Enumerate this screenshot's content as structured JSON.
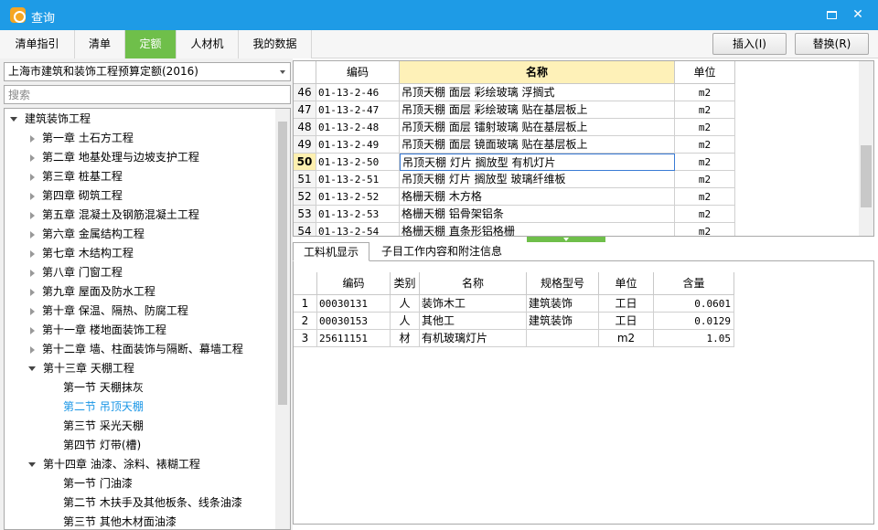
{
  "window": {
    "title": "查询",
    "maximize_icon": "maximize-icon",
    "close_glyph": "✕"
  },
  "tabs": [
    "清单指引",
    "清单",
    "定额",
    "人材机",
    "我的数据"
  ],
  "active_tab": "定额",
  "actions": {
    "insert_label": "插入(I)",
    "replace_label": "替换(R)"
  },
  "left": {
    "library": "上海市建筑和装饰工程预算定额(2016)",
    "search_placeholder": "搜索",
    "tree": [
      {
        "label": "建筑装饰工程",
        "level": 0,
        "state": "open"
      },
      {
        "label": "第一章  土石方工程",
        "level": 1,
        "state": "closed"
      },
      {
        "label": "第二章  地基处理与边坡支护工程",
        "level": 1,
        "state": "closed"
      },
      {
        "label": "第三章  桩基工程",
        "level": 1,
        "state": "closed"
      },
      {
        "label": "第四章  砌筑工程",
        "level": 1,
        "state": "closed"
      },
      {
        "label": "第五章  混凝土及钢筋混凝土工程",
        "level": 1,
        "state": "closed"
      },
      {
        "label": "第六章  金属结构工程",
        "level": 1,
        "state": "closed"
      },
      {
        "label": "第七章  木结构工程",
        "level": 1,
        "state": "closed"
      },
      {
        "label": "第八章  门窗工程",
        "level": 1,
        "state": "closed"
      },
      {
        "label": "第九章  屋面及防水工程",
        "level": 1,
        "state": "closed"
      },
      {
        "label": "第十章  保温、隔热、防腐工程",
        "level": 1,
        "state": "closed"
      },
      {
        "label": "第十一章  楼地面装饰工程",
        "level": 1,
        "state": "closed"
      },
      {
        "label": "第十二章  墙、柱面装饰与隔断、幕墙工程",
        "level": 1,
        "state": "closed"
      },
      {
        "label": "第十三章  天棚工程",
        "level": 1,
        "state": "open"
      },
      {
        "label": "第一节  天棚抹灰",
        "level": 2,
        "state": "leaf"
      },
      {
        "label": "第二节  吊顶天棚",
        "level": 2,
        "state": "leaf",
        "selected": true
      },
      {
        "label": "第三节  采光天棚",
        "level": 2,
        "state": "leaf"
      },
      {
        "label": "第四节  灯带(槽)",
        "level": 2,
        "state": "leaf"
      },
      {
        "label": "第十四章  油漆、涂料、裱糊工程",
        "level": 1,
        "state": "open"
      },
      {
        "label": "第一节  门油漆",
        "level": 2,
        "state": "leaf"
      },
      {
        "label": "第二节  木扶手及其他板条、线条油漆",
        "level": 2,
        "state": "leaf"
      },
      {
        "label": "第三节  其他木材面油漆",
        "level": 2,
        "state": "leaf"
      }
    ]
  },
  "quota_grid": {
    "headers": [
      "编码",
      "名称",
      "单位"
    ],
    "rows": [
      {
        "num": "46",
        "code": "01-13-2-46",
        "name": "吊顶天棚  面层  彩绘玻璃  浮搁式",
        "unit": "m2"
      },
      {
        "num": "47",
        "code": "01-13-2-47",
        "name": "吊顶天棚  面层  彩绘玻璃  贴在基层板上",
        "unit": "m2"
      },
      {
        "num": "48",
        "code": "01-13-2-48",
        "name": "吊顶天棚  面层  镭射玻璃  贴在基层板上",
        "unit": "m2"
      },
      {
        "num": "49",
        "code": "01-13-2-49",
        "name": "吊顶天棚  面层  镜面玻璃  贴在基层板上",
        "unit": "m2"
      },
      {
        "num": "50",
        "code": "01-13-2-50",
        "name": "吊顶天棚  灯片  搁放型  有机灯片",
        "unit": "m2",
        "current": true
      },
      {
        "num": "51",
        "code": "01-13-2-51",
        "name": "吊顶天棚  灯片  搁放型  玻璃纤维板",
        "unit": "m2"
      },
      {
        "num": "52",
        "code": "01-13-2-52",
        "name": "格栅天棚  木方格",
        "unit": "m2"
      },
      {
        "num": "53",
        "code": "01-13-2-53",
        "name": "格栅天棚  铝骨架铝条",
        "unit": "m2"
      },
      {
        "num": "54",
        "code": "01-13-2-54",
        "name": "格栅天棚  直条形铝格栅",
        "unit": "m2"
      }
    ]
  },
  "detail_tabs": [
    "工料机显示",
    "子目工作内容和附注信息"
  ],
  "detail_grid": {
    "headers": [
      "编码",
      "类别",
      "名称",
      "规格型号",
      "单位",
      "含量"
    ],
    "rows": [
      {
        "num": "1",
        "code": "00030131",
        "type": "人",
        "name": "装饰木工",
        "spec": "建筑装饰",
        "unit": "工日",
        "qty": "0.0601"
      },
      {
        "num": "2",
        "code": "00030153",
        "type": "人",
        "name": "其他工",
        "spec": "建筑装饰",
        "unit": "工日",
        "qty": "0.0129"
      },
      {
        "num": "3",
        "code": "25611151",
        "type": "材",
        "name": "有机玻璃灯片",
        "spec": "",
        "unit": "m2",
        "qty": "1.05"
      }
    ]
  }
}
